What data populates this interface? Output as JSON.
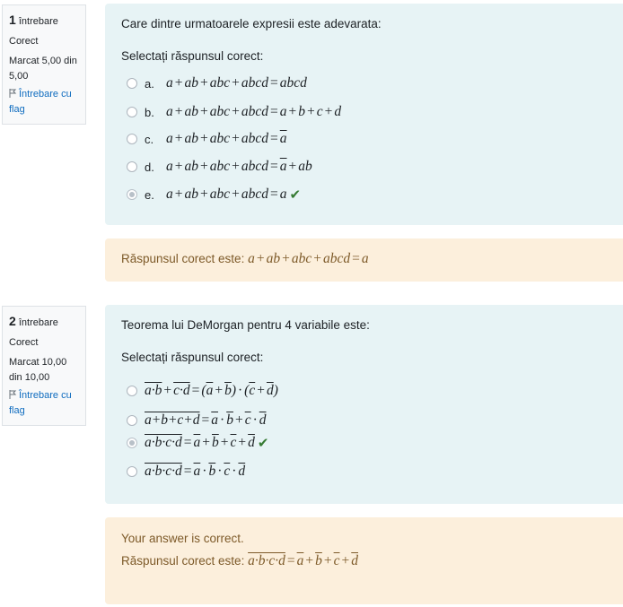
{
  "q1": {
    "info": {
      "number": "1",
      "word": "întrebare",
      "status": "Corect",
      "mark": "Marcat 5,00 din 5,00",
      "flag": "Întrebare cu flag"
    },
    "text": "Care dintre urmatoarele expresii este adevarata:",
    "prompt": "Selectați răspunsul corect:",
    "answers": [
      {
        "letter": "a.",
        "checked": false
      },
      {
        "letter": "b.",
        "checked": false
      },
      {
        "letter": "c.",
        "checked": false
      },
      {
        "letter": "d.",
        "checked": false
      },
      {
        "letter": "e.",
        "checked": true
      }
    ],
    "feedback": {
      "right_answer_label": "Răspunsul corect este:"
    }
  },
  "q2": {
    "info": {
      "number": "2",
      "word": "întrebare",
      "status": "Corect",
      "mark": "Marcat 10,00 din 10,00",
      "flag": "Întrebare cu flag"
    },
    "text": "Teorema lui DeMorgan pentru 4 variabile este:",
    "prompt": "Selectați răspunsul corect:",
    "feedback": {
      "result": "Your answer is correct.",
      "right_answer_label": "Răspunsul corect este:"
    }
  },
  "colors": {
    "correct": "#357a32",
    "link": "#0f6cbf",
    "formulation_bg": "#e7f3f5",
    "feedback_bg": "#fcefdc"
  },
  "icons": [
    "flag-icon",
    "check-icon",
    "radio-icon"
  ]
}
